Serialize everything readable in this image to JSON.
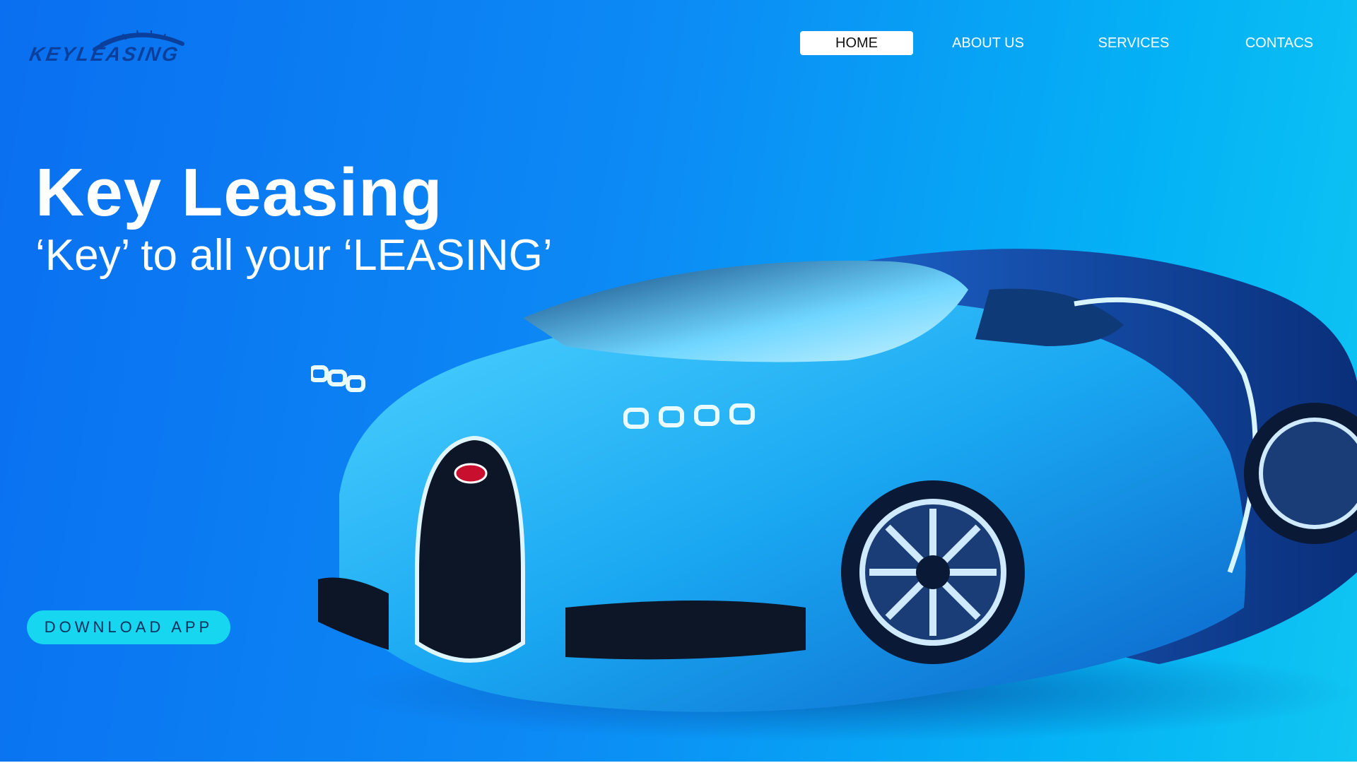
{
  "brand": {
    "logo_text": "KEYLEASING",
    "logo_icon": "speedometer-arc-icon"
  },
  "nav": {
    "items": [
      {
        "label": "HOME",
        "active": true
      },
      {
        "label": "ABOUT US",
        "active": false
      },
      {
        "label": "SERVICES",
        "active": false
      },
      {
        "label": "CONTACS",
        "active": false
      }
    ]
  },
  "hero": {
    "title": "Key Leasing",
    "tagline": "‘Key’ to all your ‘LEASING’",
    "download_label": "DOWNLOAD APP",
    "image": "blue-sports-car"
  },
  "colors": {
    "background_start": "#0a6ff0",
    "background_end": "#10c6f2",
    "button": "#16d6f0",
    "nav_active_bg": "#ffffff",
    "logo": "#0b3f9c"
  }
}
